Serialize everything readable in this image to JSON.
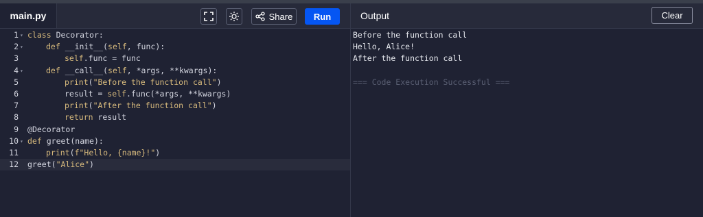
{
  "editor": {
    "tab_label": "main.py",
    "share_label": "Share",
    "run_label": "Run",
    "fullscreen_icon": "expand-icon",
    "theme_icon": "sun-icon",
    "share_icon": "share-icon",
    "lines": [
      {
        "n": "1",
        "fold": true,
        "indent": 0,
        "code": "class Decorator:"
      },
      {
        "n": "2",
        "fold": true,
        "indent": 1,
        "code": "def __init__(self, func):"
      },
      {
        "n": "3",
        "fold": false,
        "indent": 2,
        "code": "self.func = func"
      },
      {
        "n": "4",
        "fold": true,
        "indent": 1,
        "code": "def __call__(self, *args, **kwargs):"
      },
      {
        "n": "5",
        "fold": false,
        "indent": 2,
        "code": "print(\"Before the function call\")"
      },
      {
        "n": "6",
        "fold": false,
        "indent": 2,
        "code": "result = self.func(*args, **kwargs)"
      },
      {
        "n": "7",
        "fold": false,
        "indent": 2,
        "code": "print(\"After the function call\")"
      },
      {
        "n": "8",
        "fold": false,
        "indent": 2,
        "code": "return result"
      },
      {
        "n": "9",
        "fold": false,
        "indent": 0,
        "code": "@Decorator"
      },
      {
        "n": "10",
        "fold": true,
        "indent": 0,
        "code": "def greet(name):"
      },
      {
        "n": "11",
        "fold": false,
        "indent": 1,
        "code": "print(f\"Hello, {name}!\")"
      },
      {
        "n": "12",
        "fold": false,
        "indent": 0,
        "code": "greet(\"Alice\")"
      }
    ]
  },
  "output": {
    "title": "Output",
    "clear_label": "Clear",
    "lines": [
      "Before the function call",
      "Hello, Alice!",
      "After the function call",
      "",
      "=== Code Execution Successful ==="
    ]
  },
  "colors": {
    "background": "#1f2233",
    "run_button": "#0556f3",
    "keyword": "#d7ba7d",
    "success_text": "#5a5f73"
  }
}
